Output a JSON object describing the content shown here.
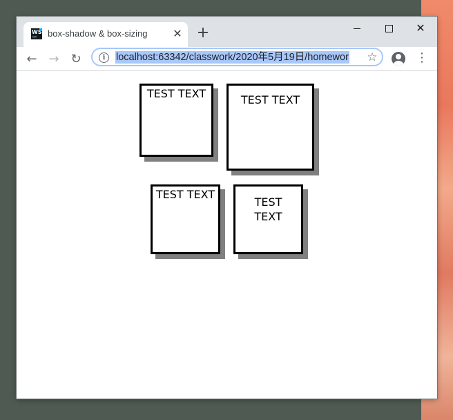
{
  "tab": {
    "title": "box-shadow & box-sizing",
    "favicon_text": "WS",
    "close_glyph": "✕",
    "favicon_icon": "webstorm-icon"
  },
  "new_tab_glyph": "+",
  "window_controls": {
    "close_glyph": "✕"
  },
  "toolbar": {
    "back_glyph": "←",
    "forward_glyph": "→",
    "reload_glyph": "↻",
    "info_glyph": "i",
    "url": "localhost:63342/classwork/2020年5月19日/homewor",
    "star_glyph": "☆",
    "menu_glyph": "⋮"
  },
  "page": {
    "boxes": [
      {
        "text": "TEST TEXT"
      },
      {
        "text": "TEST TEXT"
      },
      {
        "text": "TEST TEXT"
      },
      {
        "text": "TEST TEXT"
      }
    ]
  },
  "colors": {
    "desktop": "#4e5a52",
    "tabstrip": "#dee1e6",
    "url_highlight": "#a8c7fa",
    "box_border": "#000000",
    "box_shadow": "#808080"
  }
}
